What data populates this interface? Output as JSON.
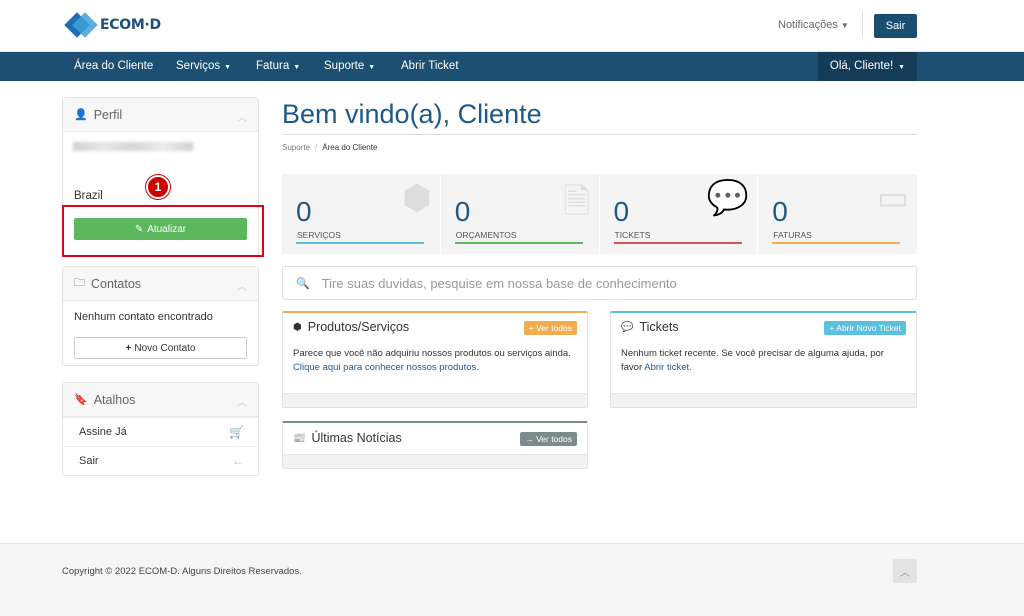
{
  "brand": {
    "logo_text": "ECOM·D"
  },
  "topbar": {
    "notifications": "Notificações",
    "logout": "Sair"
  },
  "nav": {
    "items": [
      "Área do Cliente",
      "Serviços",
      "Fatura",
      "Suporte",
      "Abrir Ticket"
    ],
    "user_menu": "Olá, Cliente!"
  },
  "sidebar": {
    "profile": {
      "title": "Perfil",
      "country": "Brazil",
      "update_button": "Atualizar",
      "step_badge": "1"
    },
    "contacts": {
      "title": "Contatos",
      "empty_text": "Nenhum contato encontrado",
      "new_button": "Novo Contato"
    },
    "shortcuts": {
      "title": "Atalhos",
      "items": [
        "Assine Já",
        "Sair"
      ]
    }
  },
  "main": {
    "title": "Bem vindo(a), Cliente",
    "breadcrumb": [
      "Suporte",
      "Área do Cliente"
    ],
    "stats": [
      {
        "value": "0",
        "label": "SERVIÇOS",
        "color": "#5bc0de"
      },
      {
        "value": "0",
        "label": "ORÇAMENTOS",
        "color": "#5cb85c"
      },
      {
        "value": "0",
        "label": "TICKETS",
        "color": "#d9534f"
      },
      {
        "value": "0",
        "label": "FATURAS",
        "color": "#f0ad4e"
      }
    ],
    "search_placeholder": "Tire suas duvidas, pesquise em nossa base de conhecimento",
    "products": {
      "title": "Produtos/Serviços",
      "button": "Ver todos",
      "text": "Parece que você não adquiriu nossos produtos ou serviços ainda.",
      "link": "Clique aqui para conhecer nossos produtos."
    },
    "tickets": {
      "title": "Tickets",
      "button": "Abrir Novo Ticket",
      "text": "Nenhum ticket recente. Se você precisar de alguma ajuda, por favor",
      "link": "Abrir ticket."
    },
    "news": {
      "title": "Últimas Notícias",
      "button": "Ver todos"
    }
  },
  "footer": {
    "copyright": "Copyright © 2022 ECOM-D. Alguns Direitos Reservados."
  },
  "colors": {
    "primary": "#1d4f72",
    "accent_green": "#5cb85c",
    "highlight_red": "#e0001a"
  }
}
